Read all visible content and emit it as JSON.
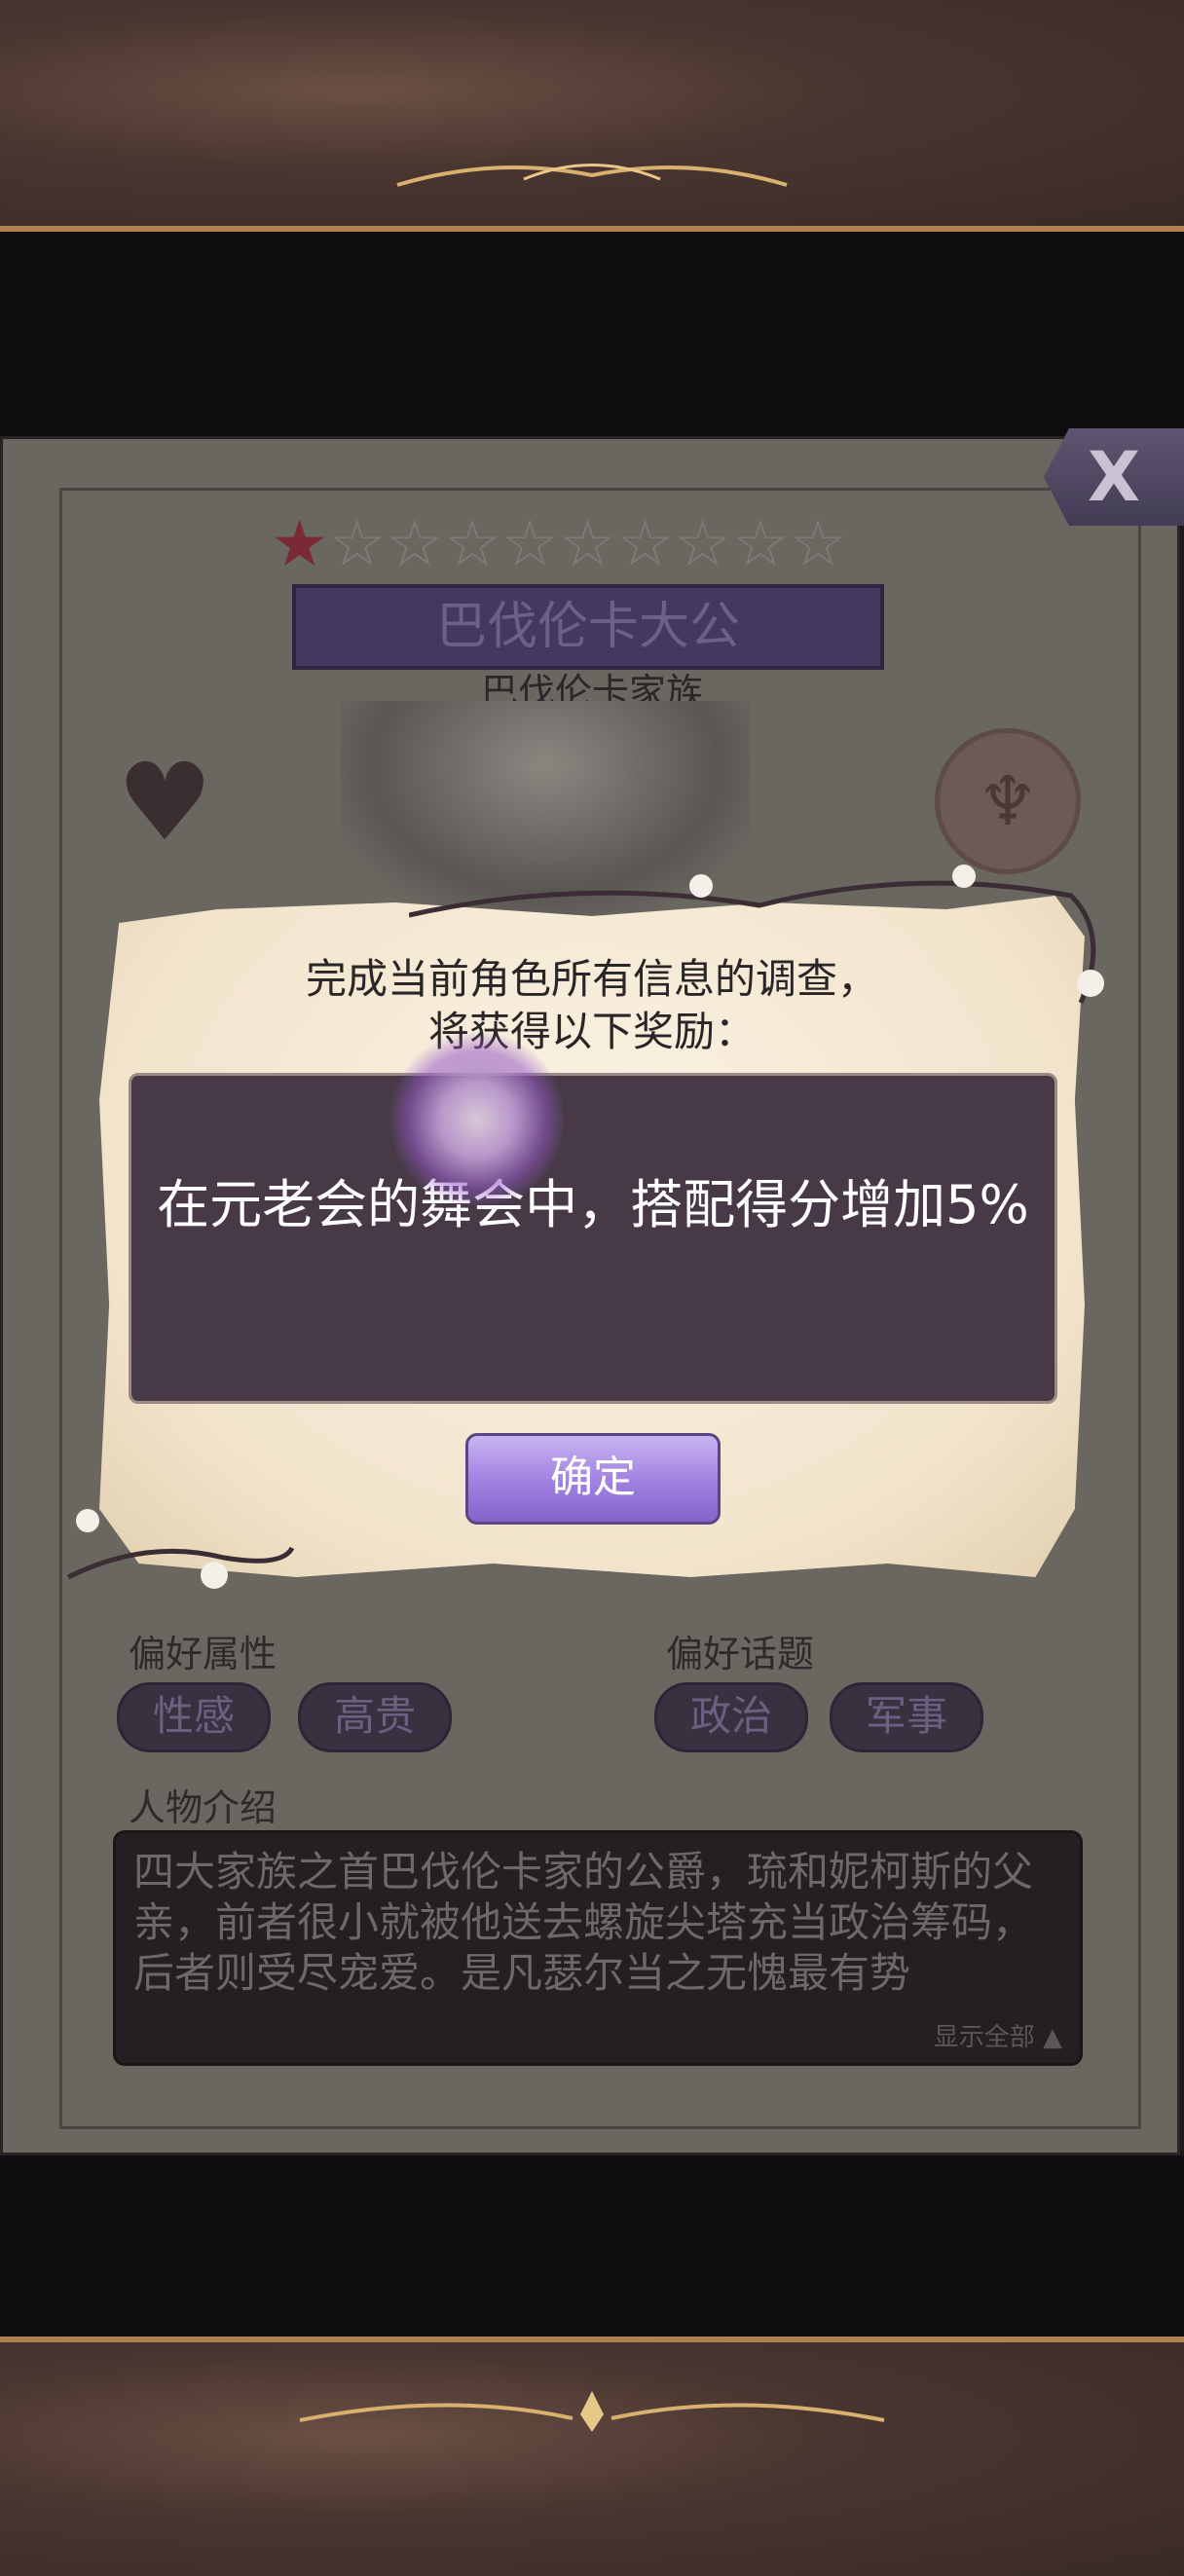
{
  "character": {
    "stars_filled": "★",
    "stars_empty": "☆☆☆☆☆☆☆☆☆",
    "rating": 1,
    "rating_max": 10,
    "name": "巴伐伦卡大公",
    "family": "巴伐伦卡家族"
  },
  "close": {
    "label": "X"
  },
  "preferences": {
    "attribute_label": "偏好属性",
    "attributes": [
      "性感",
      "高贵"
    ],
    "topic_label": "偏好话题",
    "topics": [
      "政治",
      "军事"
    ]
  },
  "intro": {
    "label": "人物介绍",
    "text": "四大家族之首巴伐伦卡家的公爵，琉和妮柯斯的父亲，前者很小就被他送去螺旋尖塔充当政治筹码，后者则受尽宠爱。是凡瑟尔当之无愧最有势",
    "show_all": "显示全部 ▲"
  },
  "dialog": {
    "line1": "完成当前角色所有信息的调查，",
    "line2": "将获得以下奖励：",
    "reward": "在元老会的舞会中，搭配得分增加5%",
    "confirm": "确定"
  },
  "colors": {
    "accent_purple": "#9f7fe0",
    "reward_box": "#473a46",
    "frame_brown": "#4a3630"
  }
}
